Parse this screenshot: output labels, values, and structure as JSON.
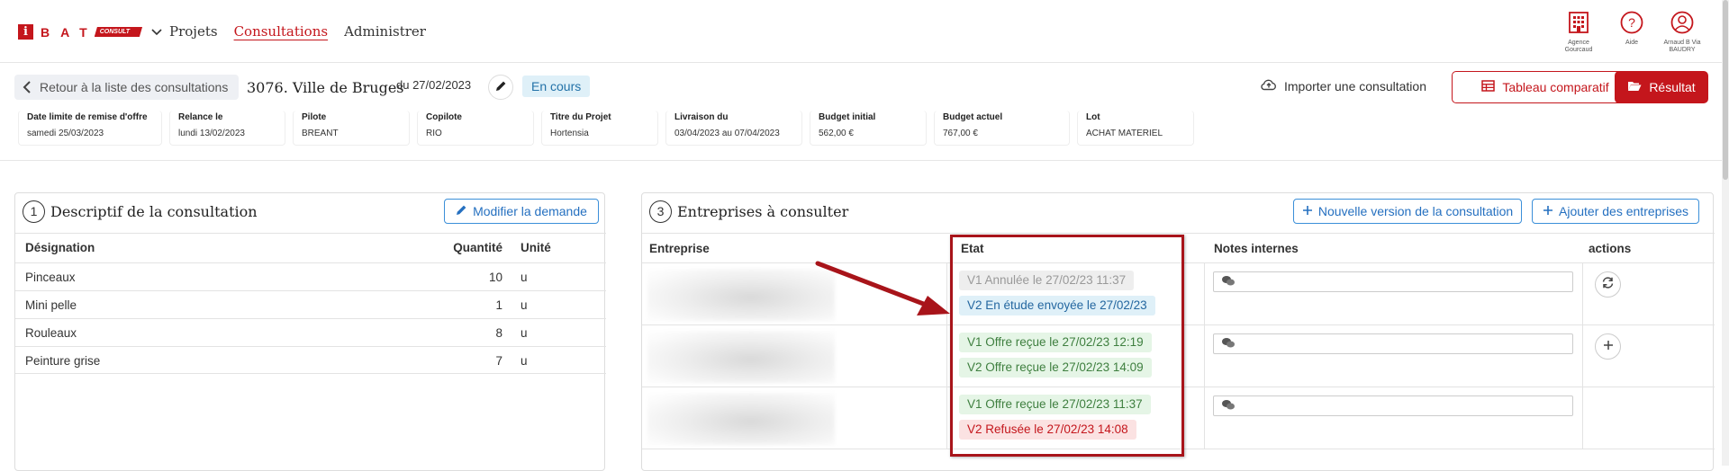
{
  "topbar": {
    "logo_i": "i",
    "logo_letters": "BAT",
    "logo_consult": "CONSULT",
    "nav": [
      {
        "label": "Projets",
        "active": false
      },
      {
        "label": "Consultations",
        "active": true
      },
      {
        "label": "Administrer",
        "active": false
      }
    ],
    "right": [
      {
        "icon": "building-icon",
        "label": "Agence Gourcaud"
      },
      {
        "icon": "help-icon",
        "label": "Aide"
      },
      {
        "icon": "user-icon",
        "label": "Arnaud B Via BAUDRY"
      }
    ]
  },
  "subheader": {
    "back_label": "Retour à la liste des consultations",
    "title": "3076. Ville de Bruges",
    "date": "du 27/02/2023",
    "status": "En cours",
    "import_label": "Importer une consultation",
    "compare_label": "Tableau comparatif",
    "result_label": "Résultat",
    "fields": [
      {
        "label": "Date limite de remise d'offre",
        "value": "samedi 25/03/2023"
      },
      {
        "label": "Relance le",
        "value": "lundi 13/02/2023"
      },
      {
        "label": "Pilote",
        "value": "BREANT"
      },
      {
        "label": "Copilote",
        "value": "RIO"
      },
      {
        "label": "Titre du Projet",
        "value": "Hortensia"
      },
      {
        "label": "Livraison du",
        "value": "03/04/2023 au 07/04/2023"
      },
      {
        "label": "Budget initial",
        "value": "562,00 €"
      },
      {
        "label": "Budget actuel",
        "value": "767,00 €"
      },
      {
        "label": "Lot",
        "value": "ACHAT MATERIEL"
      }
    ]
  },
  "descriptif": {
    "num": "1",
    "title": "Descriptif de la consultation",
    "edit_label": "Modifier la demande",
    "headers": {
      "designation": "Désignation",
      "quantite": "Quantité",
      "unite": "Unité"
    },
    "rows": [
      {
        "designation": "Pinceaux",
        "quantite": "10",
        "unite": "u"
      },
      {
        "designation": "Mini pelle",
        "quantite": "1",
        "unite": "u"
      },
      {
        "designation": "Rouleaux",
        "quantite": "8",
        "unite": "u"
      },
      {
        "designation": "Peinture grise",
        "quantite": "7",
        "unite": "u"
      }
    ]
  },
  "entreprises": {
    "num": "3",
    "title": "Entreprises à consulter",
    "new_version_label": "Nouvelle version de la consultation",
    "add_label": "Ajouter des entreprises",
    "headers": {
      "entreprise": "Entreprise",
      "etat": "Etat",
      "notes": "Notes internes",
      "actions": "actions"
    },
    "rows": [
      {
        "states": [
          {
            "text": "V1 Annulée le 27/02/23 11:37",
            "color": "grey"
          },
          {
            "text": "V2 En étude envoyée le 27/02/23",
            "color": "blue"
          }
        ],
        "action": "refresh-icon"
      },
      {
        "states": [
          {
            "text": "V1 Offre reçue le 27/02/23 12:19",
            "color": "green"
          },
          {
            "text": "V2 Offre reçue le 27/02/23 14:09",
            "color": "green"
          }
        ],
        "action": "plus-icon"
      },
      {
        "states": [
          {
            "text": "V1 Offre reçue le 27/02/23 11:37",
            "color": "green"
          },
          {
            "text": "V2 Refusée le 27/02/23 14:08",
            "color": "red"
          }
        ],
        "action": ""
      }
    ]
  },
  "colors": {
    "brand": "#c4161c",
    "link": "#2570c0",
    "annotation": "#a8141a"
  }
}
